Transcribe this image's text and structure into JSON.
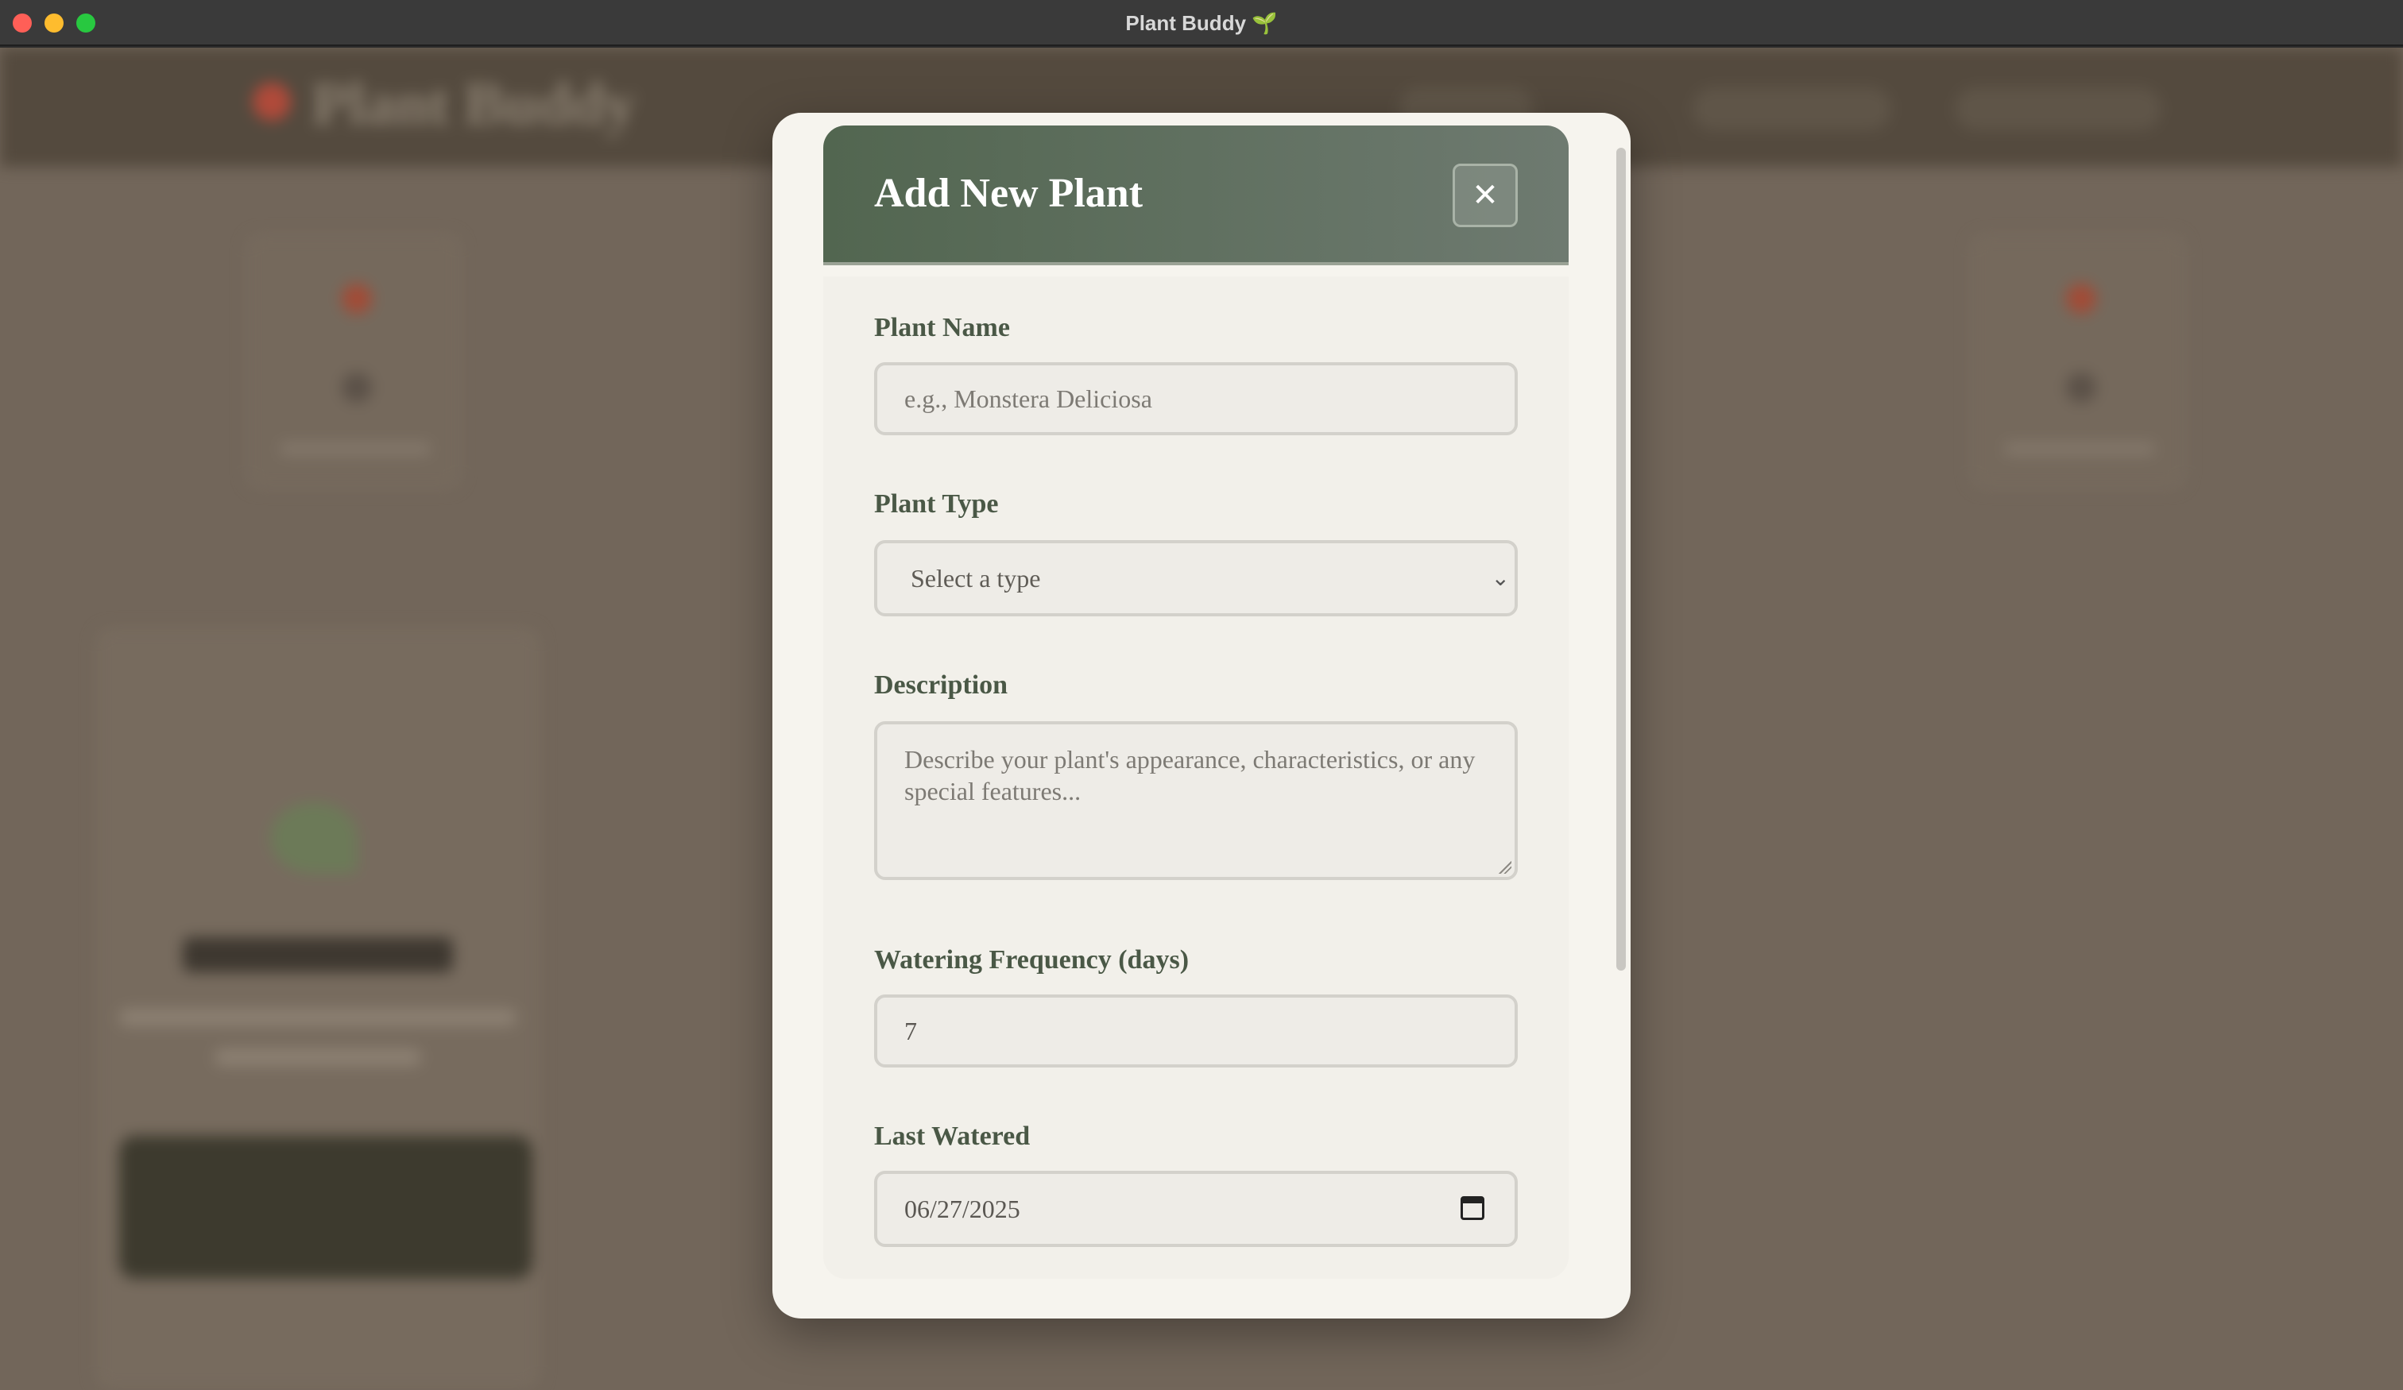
{
  "window": {
    "title": "Plant Buddy 🌱"
  },
  "background_app": {
    "logo_text": "Plant Buddy"
  },
  "modal": {
    "title": "Add New Plant",
    "close_label": "✕",
    "fields": {
      "plant_name": {
        "label": "Plant Name",
        "placeholder": "e.g., Monstera Deliciosa",
        "value": ""
      },
      "plant_type": {
        "label": "Plant Type",
        "selected": "Select a type",
        "chevron": "⌄"
      },
      "description": {
        "label": "Description",
        "placeholder": "Describe your plant's appearance, characteristics, or any special features..."
      },
      "watering_frequency": {
        "label": "Watering Frequency (days)",
        "value": "7"
      },
      "last_watered": {
        "label": "Last Watered",
        "value": "06/27/2025"
      }
    }
  },
  "colors": {
    "header_gradient_start": "#526650",
    "header_gradient_end": "#6e7a70",
    "label_green": "#4a5846",
    "modal_bg": "#f6f4ee"
  }
}
